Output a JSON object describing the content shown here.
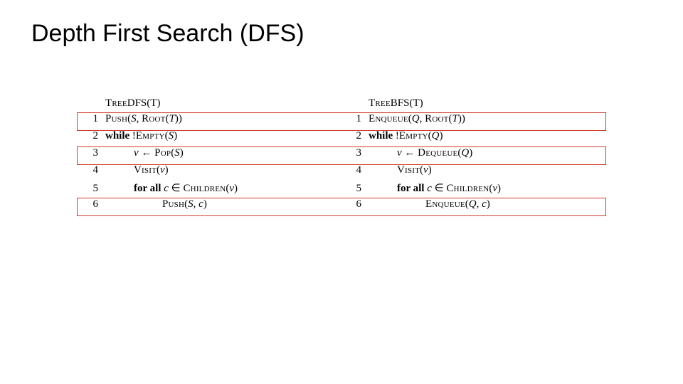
{
  "title": "Depth First Search (DFS)",
  "left": {
    "header_sc": "Tree",
    "header_name": "DFS",
    "header_arg": "(T)",
    "lines": [
      {
        "n": "1",
        "indent": 0,
        "html": "<span class='sc'>Push</span>(<span class='it'>S</span>, <span class='sc'>Root</span>(<span class='it'>T</span>))"
      },
      {
        "n": "2",
        "indent": 0,
        "html": "<span class='bf'>while</span> !<span class='sc'>Empty</span>(<span class='it'>S</span>)"
      },
      {
        "n": "3",
        "indent": 1,
        "html": "<span class='it'>v</span> ← <span class='sc'>Pop</span>(<span class='it'>S</span>)"
      },
      {
        "n": "4",
        "indent": 1,
        "html": "<span class='sc'>Visit</span>(<span class='it'>v</span>)"
      },
      {
        "n": "5",
        "indent": 1,
        "html": "<span class='bf'>for all</span> <span class='it'>c</span> ∈ <span class='sc'>Children</span>(<span class='it'>v</span>)"
      },
      {
        "n": "6",
        "indent": 2,
        "html": "<span class='sc'>Push</span>(<span class='it'>S</span>, <span class='it'>c</span>)"
      }
    ]
  },
  "right": {
    "header_sc": "Tree",
    "header_name": "BFS",
    "header_arg": "(T)",
    "lines": [
      {
        "n": "1",
        "indent": 0,
        "html": "<span class='sc'>Enqueue</span>(<span class='it'>Q</span>, <span class='sc'>Root</span>(<span class='it'>T</span>))"
      },
      {
        "n": "2",
        "indent": 0,
        "html": "<span class='bf'>while</span> !<span class='sc'>Empty</span>(<span class='it'>Q</span>)"
      },
      {
        "n": "3",
        "indent": 1,
        "html": "<span class='it'>v</span> ← <span class='sc'>Dequeue</span>(<span class='it'>Q</span>)"
      },
      {
        "n": "4",
        "indent": 1,
        "html": "<span class='sc'>Visit</span>(<span class='it'>v</span>)"
      },
      {
        "n": "5",
        "indent": 1,
        "html": "<span class='bf'>for all</span> <span class='it'>c</span> ∈ <span class='sc'>Children</span>(<span class='it'>v</span>)"
      },
      {
        "n": "6",
        "indent": 2,
        "html": "<span class='sc'>Enqueue</span>(<span class='it'>Q</span>, <span class='it'>c</span>)"
      }
    ]
  },
  "highlight_rows": [
    1,
    3,
    6
  ],
  "highlight_color": "#d23a2a"
}
